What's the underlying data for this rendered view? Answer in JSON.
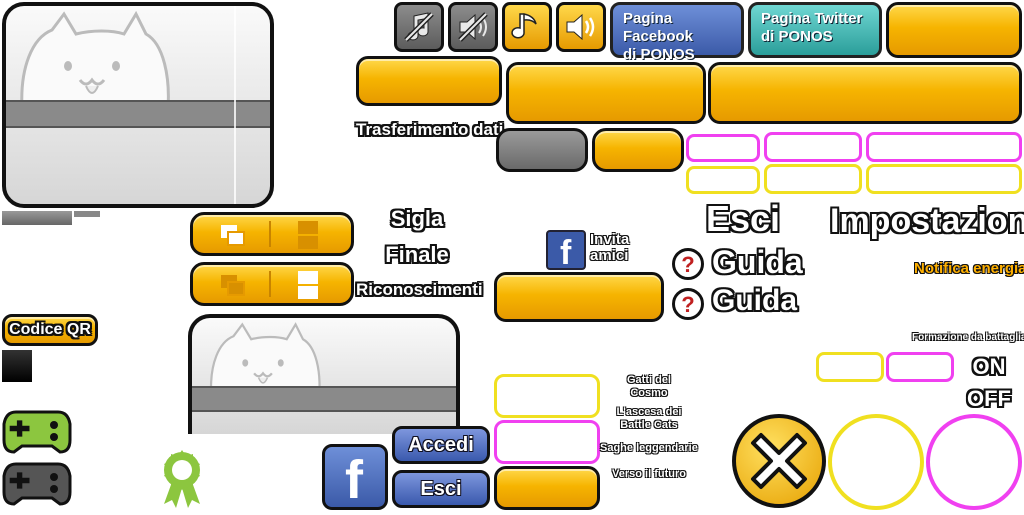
{
  "sound_buttons": [
    {
      "icon": "music-muted-icon",
      "state": "off"
    },
    {
      "icon": "speaker-muted-icon",
      "state": "off"
    },
    {
      "icon": "music-note-icon",
      "state": "on"
    },
    {
      "icon": "speaker-icon",
      "state": "on"
    }
  ],
  "social": {
    "facebook_page": "Pagina Facebook\ndi PONOS",
    "twitter_page": "Pagina Twitter\ndi PONOS"
  },
  "labels": {
    "data_transfer": "Trasferimento dati",
    "opening": "Sigla",
    "ending": "Finale",
    "credits": "Riconoscimenti",
    "invite": "Invita\namici",
    "exit": "Esci",
    "guide_1": "Guida",
    "guide_2": "Guida",
    "settings": "Impostazioni",
    "energy_notification": "Notifica energia",
    "qr_code": "Codice QR",
    "battle_formation": "Formazione da battaglia",
    "on": "ON",
    "off": "OFF"
  },
  "story_titles": [
    "Gatti del\nCosmo",
    "L'ascesa dei\nBattle Cats",
    "Saghe leggendarie",
    "Verso il futuro"
  ],
  "account": {
    "login": "Accedi",
    "logout": "Esci"
  },
  "colors": {
    "orange": "#f6b400",
    "pink_outline": "#f040f0",
    "yellow_outline": "#f0e020",
    "facebook_blue": "#3b5aa8",
    "twitter_teal": "#2b9e9a",
    "controller_green": "#8cc63f",
    "controller_gray": "#555555",
    "ribbon_green": "#8cc63f"
  }
}
